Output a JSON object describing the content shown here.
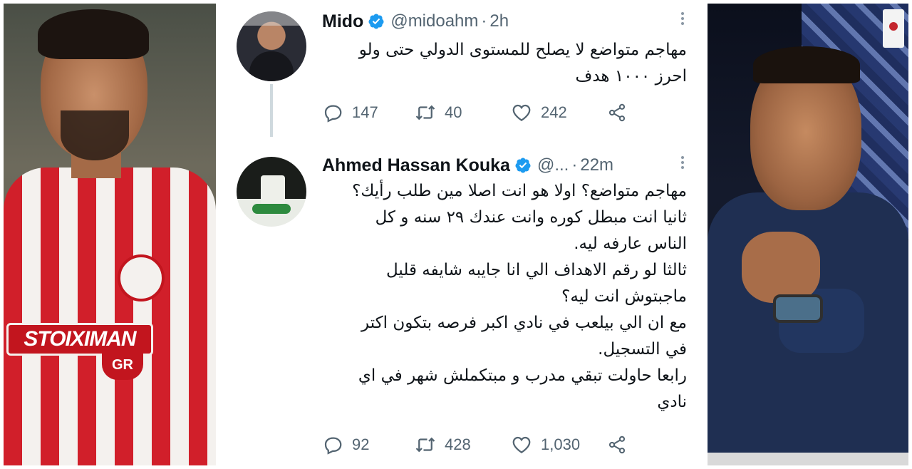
{
  "tweets": [
    {
      "author_name": "Mido",
      "handle": "@midoahm",
      "separator": "·",
      "time": "2h",
      "text_lines": [
        "مهاجم متواضع لا يصلح للمستوى الدولي حتى ولو",
        "احرز ١٠٠٠ هدف"
      ],
      "stats": {
        "replies": "147",
        "retweets": "40",
        "likes": "242"
      }
    },
    {
      "author_name": "Ahmed Hassan Kouka",
      "handle": "@...",
      "separator": "·",
      "time": "22m",
      "text_lines": [
        "مهاجم متواضع؟ اولا هو انت اصلا مين طلب رأيك؟",
        "ثانيا انت مبطل كوره وانت عندك ٢٩ سنه و كل",
        "الناس عارفه ليه.",
        "ثالثا لو رقم الاهداف الي انا جايبه شايفه قليل",
        "ماجبتوش انت ليه؟",
        "مع ان الي بيلعب في نادي اكبر فرصه بتكون اكتر",
        "في التسجيل.",
        "رابعا حاولت تبقي مدرب و مبتكملش شهر في اي",
        "نادي"
      ],
      "stats": {
        "replies": "92",
        "retweets": "428",
        "likes": "1,030"
      }
    }
  ],
  "icons": {
    "verified": "verified-badge-icon",
    "reply": "reply-icon",
    "retweet": "retweet-icon",
    "like": "heart-icon",
    "share": "share-icon",
    "more": "more-options-icon"
  },
  "colors": {
    "verified_blue": "#1d9bf0",
    "muted": "#536471",
    "text": "#0f1419",
    "olympiacos_red": "#d11f2a"
  },
  "photos": {
    "left_sponsor_text": "STOIXIMAN",
    "left_sponsor_sub": "GR"
  }
}
